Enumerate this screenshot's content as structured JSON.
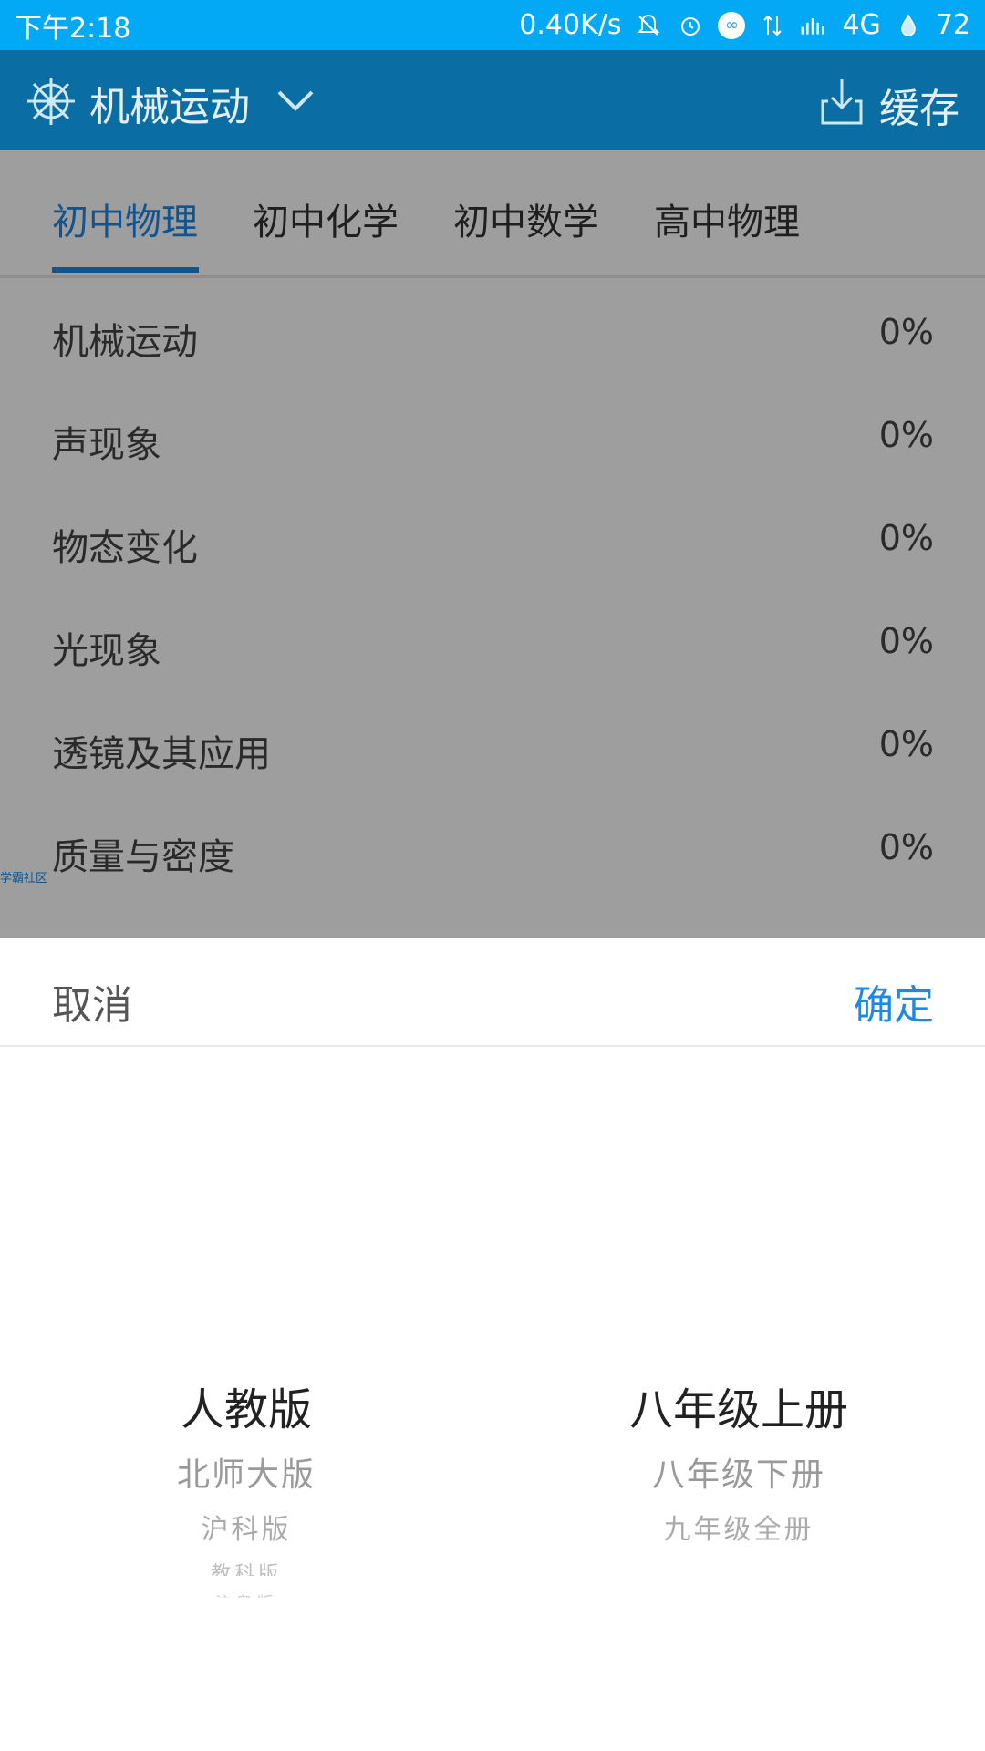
{
  "status_bar": {
    "time": "下午2:18",
    "net_speed": "0.40K/s",
    "network": "4G",
    "battery": "72",
    "icons": [
      "bell-off-icon",
      "alarm-icon",
      "link-icon",
      "data-arrows-icon",
      "signal-icon",
      "battery-icon"
    ]
  },
  "app_bar": {
    "icon": "wheel-icon",
    "title": "机械运动",
    "dropdown_icon": "chevron-down-icon",
    "download_icon": "download-icon",
    "cache_label": "缓存"
  },
  "tabs": [
    {
      "label": "初中物理",
      "active": true
    },
    {
      "label": "初中化学",
      "active": false
    },
    {
      "label": "初中数学",
      "active": false
    },
    {
      "label": "高中物理",
      "active": false
    }
  ],
  "chapters": [
    {
      "name": "机械运动",
      "progress": "0%"
    },
    {
      "name": "声现象",
      "progress": "0%"
    },
    {
      "name": "物态变化",
      "progress": "0%"
    },
    {
      "name": "光现象",
      "progress": "0%"
    },
    {
      "name": "透镜及其应用",
      "progress": "0%"
    },
    {
      "name": "质量与密度",
      "progress": "0%"
    }
  ],
  "watermark": "学霸社区",
  "sheet": {
    "cancel": "取消",
    "confirm": "确定",
    "edition_picker": {
      "selected": "人教版",
      "options": [
        "北师大版",
        "沪科版",
        "教科版",
        "沪粤版"
      ]
    },
    "grade_picker": {
      "selected": "八年级上册",
      "options": [
        "八年级下册",
        "九年级全册"
      ]
    }
  },
  "colors": {
    "status_bar": "#03A9F4",
    "app_bar": "#0A6EA5",
    "accent": "#1E88E5"
  }
}
